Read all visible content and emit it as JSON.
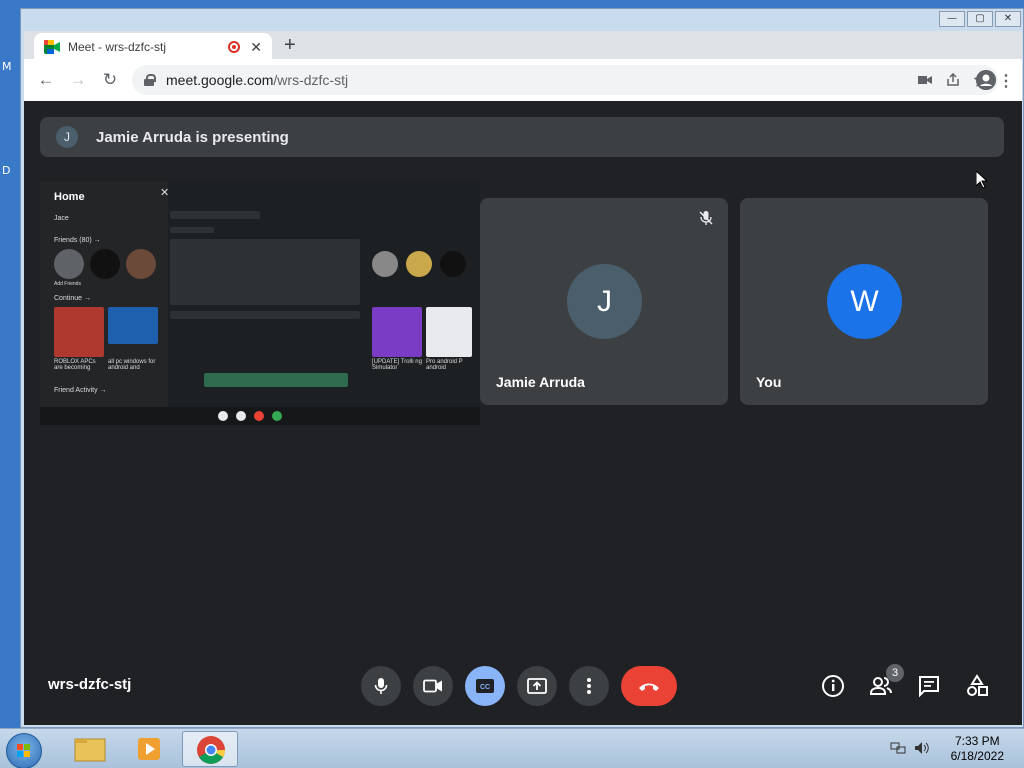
{
  "desktop": {
    "letter_top": "M",
    "letter_mid": "D"
  },
  "window": {
    "controls": [
      "—",
      "▢",
      "✕"
    ]
  },
  "browser": {
    "tab_title": "Meet - wrs-dzfc-stj",
    "tab_close": "✕",
    "new_tab": "+",
    "url_host": "meet.google.com",
    "url_path": "/wrs-dzfc-stj",
    "nav": {
      "back": "←",
      "forward": "→",
      "reload": "↻"
    },
    "menu": "⋮"
  },
  "meet": {
    "banner_avatar": "J",
    "banner_text": "Jamie Arruda is presenting",
    "presentation": {
      "home": "Home",
      "close": "✕",
      "user": "Jace",
      "friends": "Friends (80) →",
      "add_friends": "Add Friends",
      "continue": "Continue →",
      "game1": "ROBLOX APCs are becoming",
      "game2": "all pc windows for android and",
      "game3": "[UPDATE] Trolli ng Simulator",
      "game4": "Pro android P android",
      "friend_activity": "Friend Activity →"
    },
    "participants": [
      {
        "initial": "J",
        "name": "Jamie Arruda",
        "color": "#4a5e6b",
        "muted": true
      },
      {
        "initial": "W",
        "name": "You",
        "color": "#1a73e8",
        "muted": false
      }
    ],
    "meeting_code": "wrs-dzfc-stj",
    "people_count": "3"
  },
  "taskbar": {
    "time": "7:33 PM",
    "date": "6/18/2022"
  }
}
